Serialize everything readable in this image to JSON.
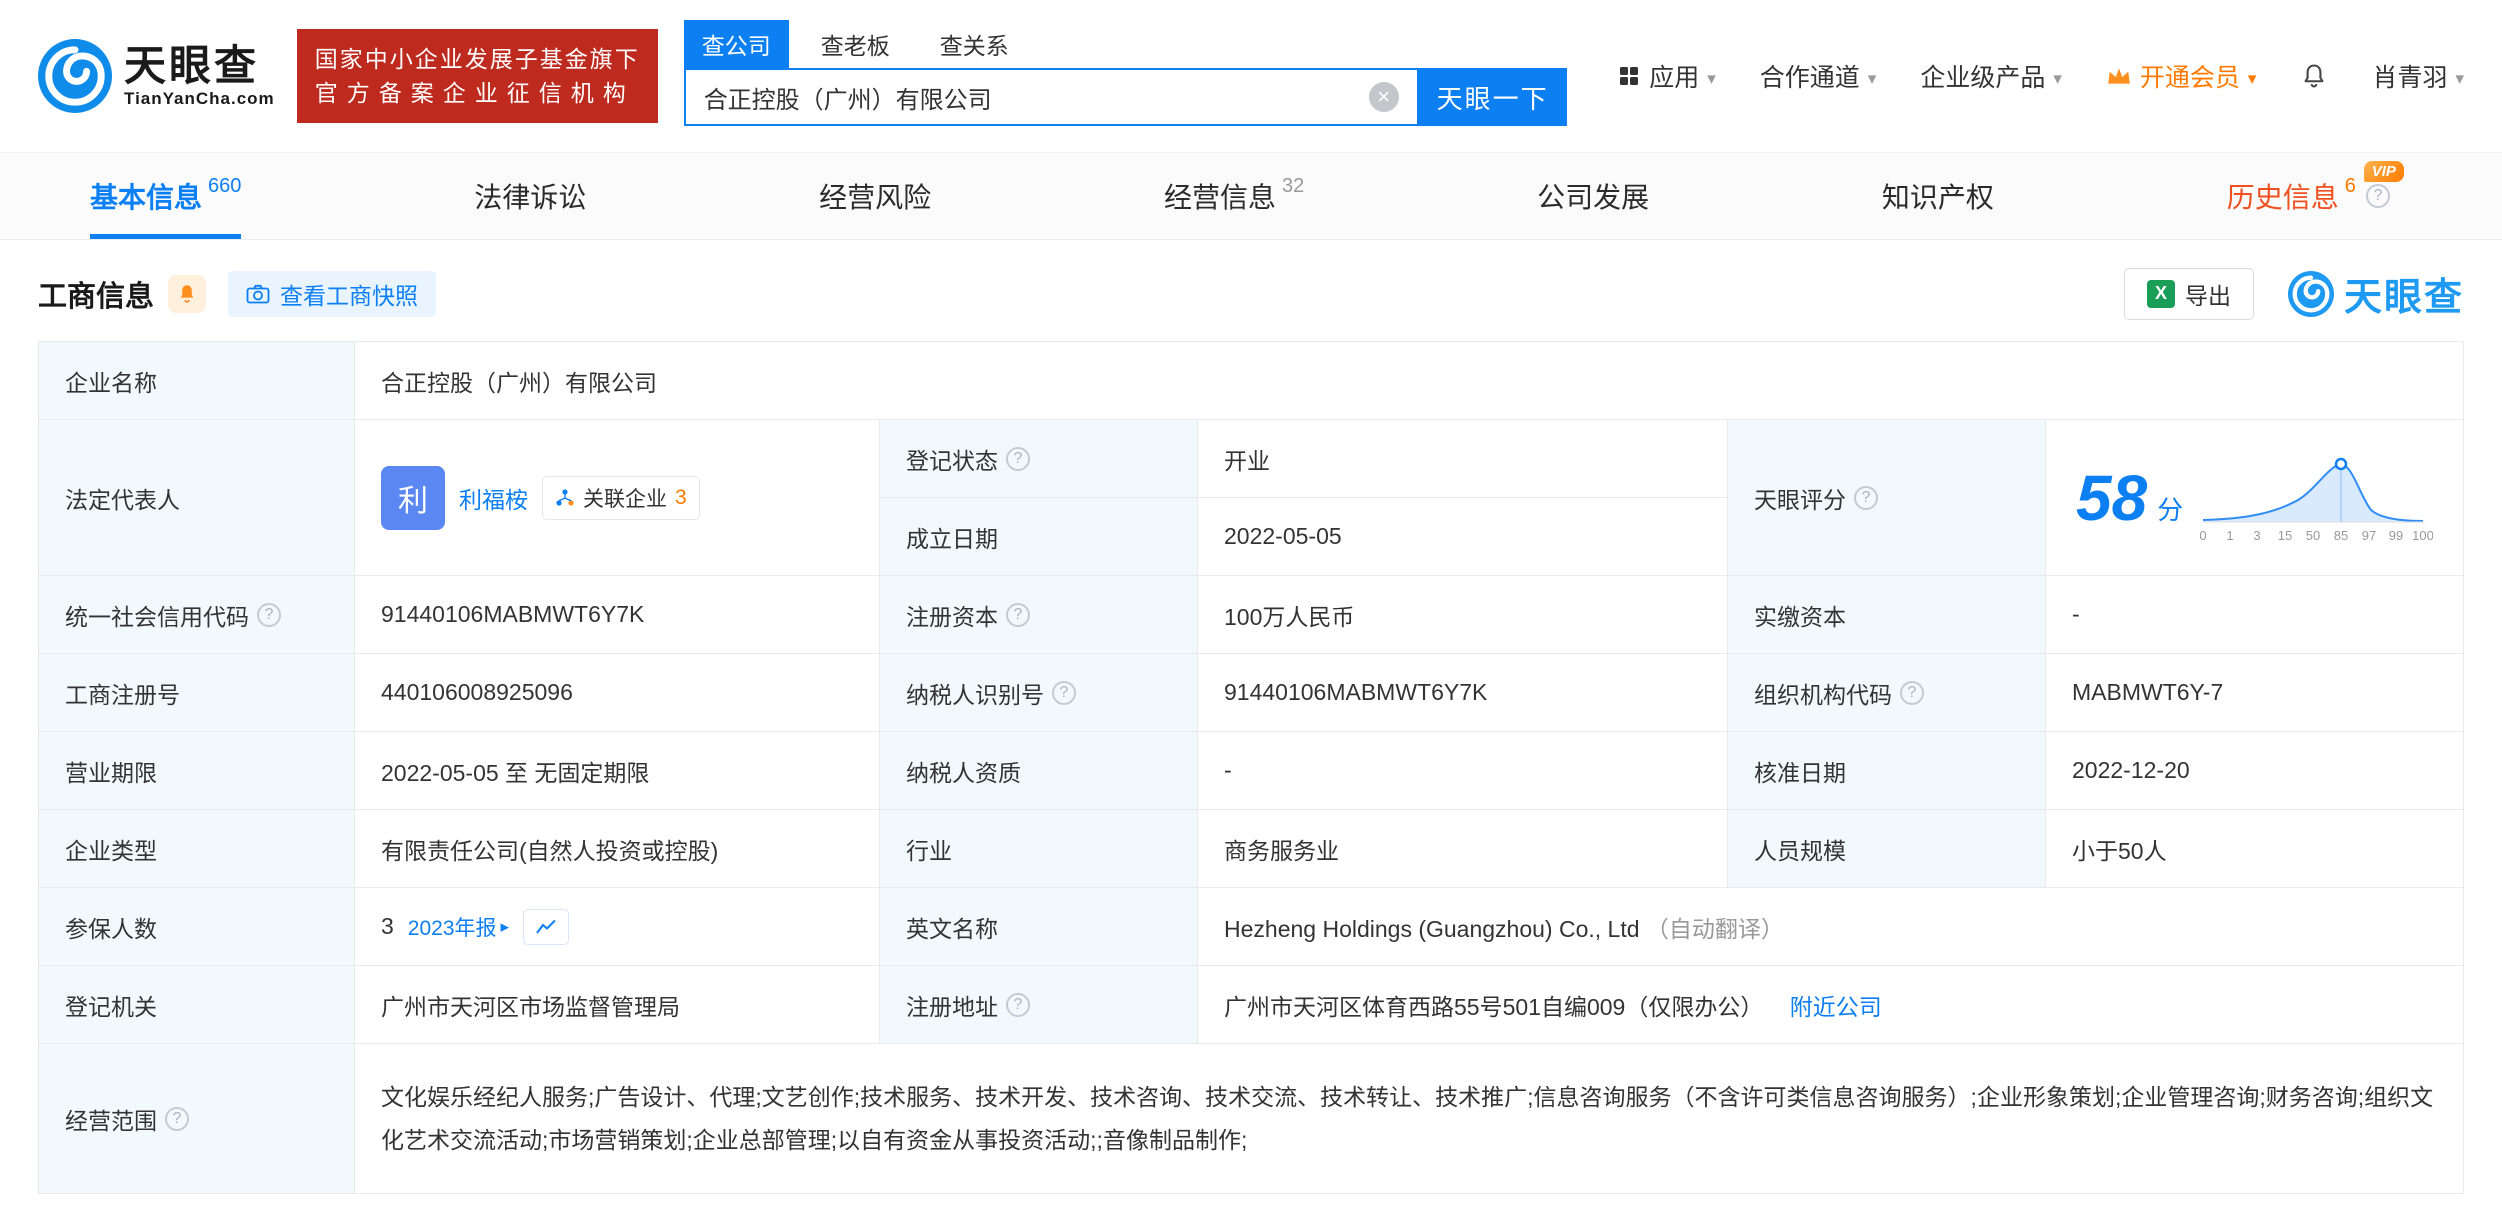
{
  "brand": {
    "logo_text": "天眼查",
    "logo_sub": "TianYanCha.com",
    "badge_line1": "国家中小企业发展子基金旗下",
    "badge_line2": "官方备案企业征信机构"
  },
  "search": {
    "tab_company": "查公司",
    "tab_boss": "查老板",
    "tab_relation": "查关系",
    "value": "合正控股（广州）有限公司",
    "button_label": "天眼一下"
  },
  "top_nav": {
    "apps": "应用",
    "partner": "合作通道",
    "enterprise": "企业级产品",
    "vip": "开通会员",
    "user": "肖青羽"
  },
  "page_tabs": {
    "basic": {
      "label": "基本信息",
      "count": "660"
    },
    "legal": {
      "label": "法律诉讼"
    },
    "risk": {
      "label": "经营风险"
    },
    "operation": {
      "label": "经营信息",
      "count": "32"
    },
    "development": {
      "label": "公司发展"
    },
    "ip": {
      "label": "知识产权"
    },
    "history": {
      "label": "历史信息",
      "count": "6",
      "vip_badge": "VIP"
    }
  },
  "section": {
    "title": "工商信息",
    "snapshot_button": "查看工商快照",
    "export_button": "导出",
    "watermark": "天眼查"
  },
  "score": {
    "label": "天眼评分",
    "value": "58",
    "unit": "分",
    "axis": [
      "0",
      "1",
      "3",
      "15",
      "50",
      "85",
      "97",
      "99",
      "100"
    ]
  },
  "fields": {
    "company_name_label": "企业名称",
    "company_name": "合正控股（广州）有限公司",
    "legal_rep_label": "法定代表人",
    "avatar_char": "利",
    "legal_rep": "利福桉",
    "related_label": "关联企业",
    "related_count": "3",
    "reg_status_label": "登记状态",
    "reg_status": "开业",
    "est_date_label": "成立日期",
    "est_date": "2022-05-05",
    "credit_code_label": "统一社会信用代码",
    "credit_code": "91440106MABMWT6Y7K",
    "reg_capital_label": "注册资本",
    "reg_capital": "100万人民币",
    "paid_capital_label": "实缴资本",
    "paid_capital": "-",
    "reg_no_label": "工商注册号",
    "reg_no": "440106008925096",
    "taxpayer_no_label": "纳税人识别号",
    "taxpayer_no": "91440106MABMWT6Y7K",
    "org_code_label": "组织机构代码",
    "org_code": "MABMWT6Y-7",
    "term_label": "营业期限",
    "term": "2022-05-05 至 无固定期限",
    "taxpayer_quality_label": "纳税人资质",
    "taxpayer_quality": "-",
    "approval_date_label": "核准日期",
    "approval_date": "2022-12-20",
    "type_label": "企业类型",
    "type": "有限责任公司(自然人投资或控股)",
    "industry_label": "行业",
    "industry": "商务服务业",
    "staff_label": "人员规模",
    "staff": "小于50人",
    "insured_label": "参保人数",
    "insured": "3",
    "annual_report": "2023年报",
    "en_name_label": "英文名称",
    "en_name": "Hezheng Holdings (Guangzhou) Co., Ltd",
    "en_name_note": "（自动翻译）",
    "authority_label": "登记机关",
    "authority": "广州市天河区市场监督管理局",
    "address_label": "注册地址",
    "address": "广州市天河区体育西路55号501自编009（仅限办公）",
    "nearby": "附近公司",
    "scope_label": "经营范围",
    "scope": "文化娱乐经纪人服务;广告设计、代理;文艺创作;技术服务、技术开发、技术咨询、技术交流、技术转让、技术推广;信息咨询服务（不含许可类信息咨询服务）;企业形象策划;企业管理咨询;财务咨询;组织文化艺术交流活动;市场营销策划;企业总部管理;以自有资金从事投资活动;;音像制品制作;"
  }
}
